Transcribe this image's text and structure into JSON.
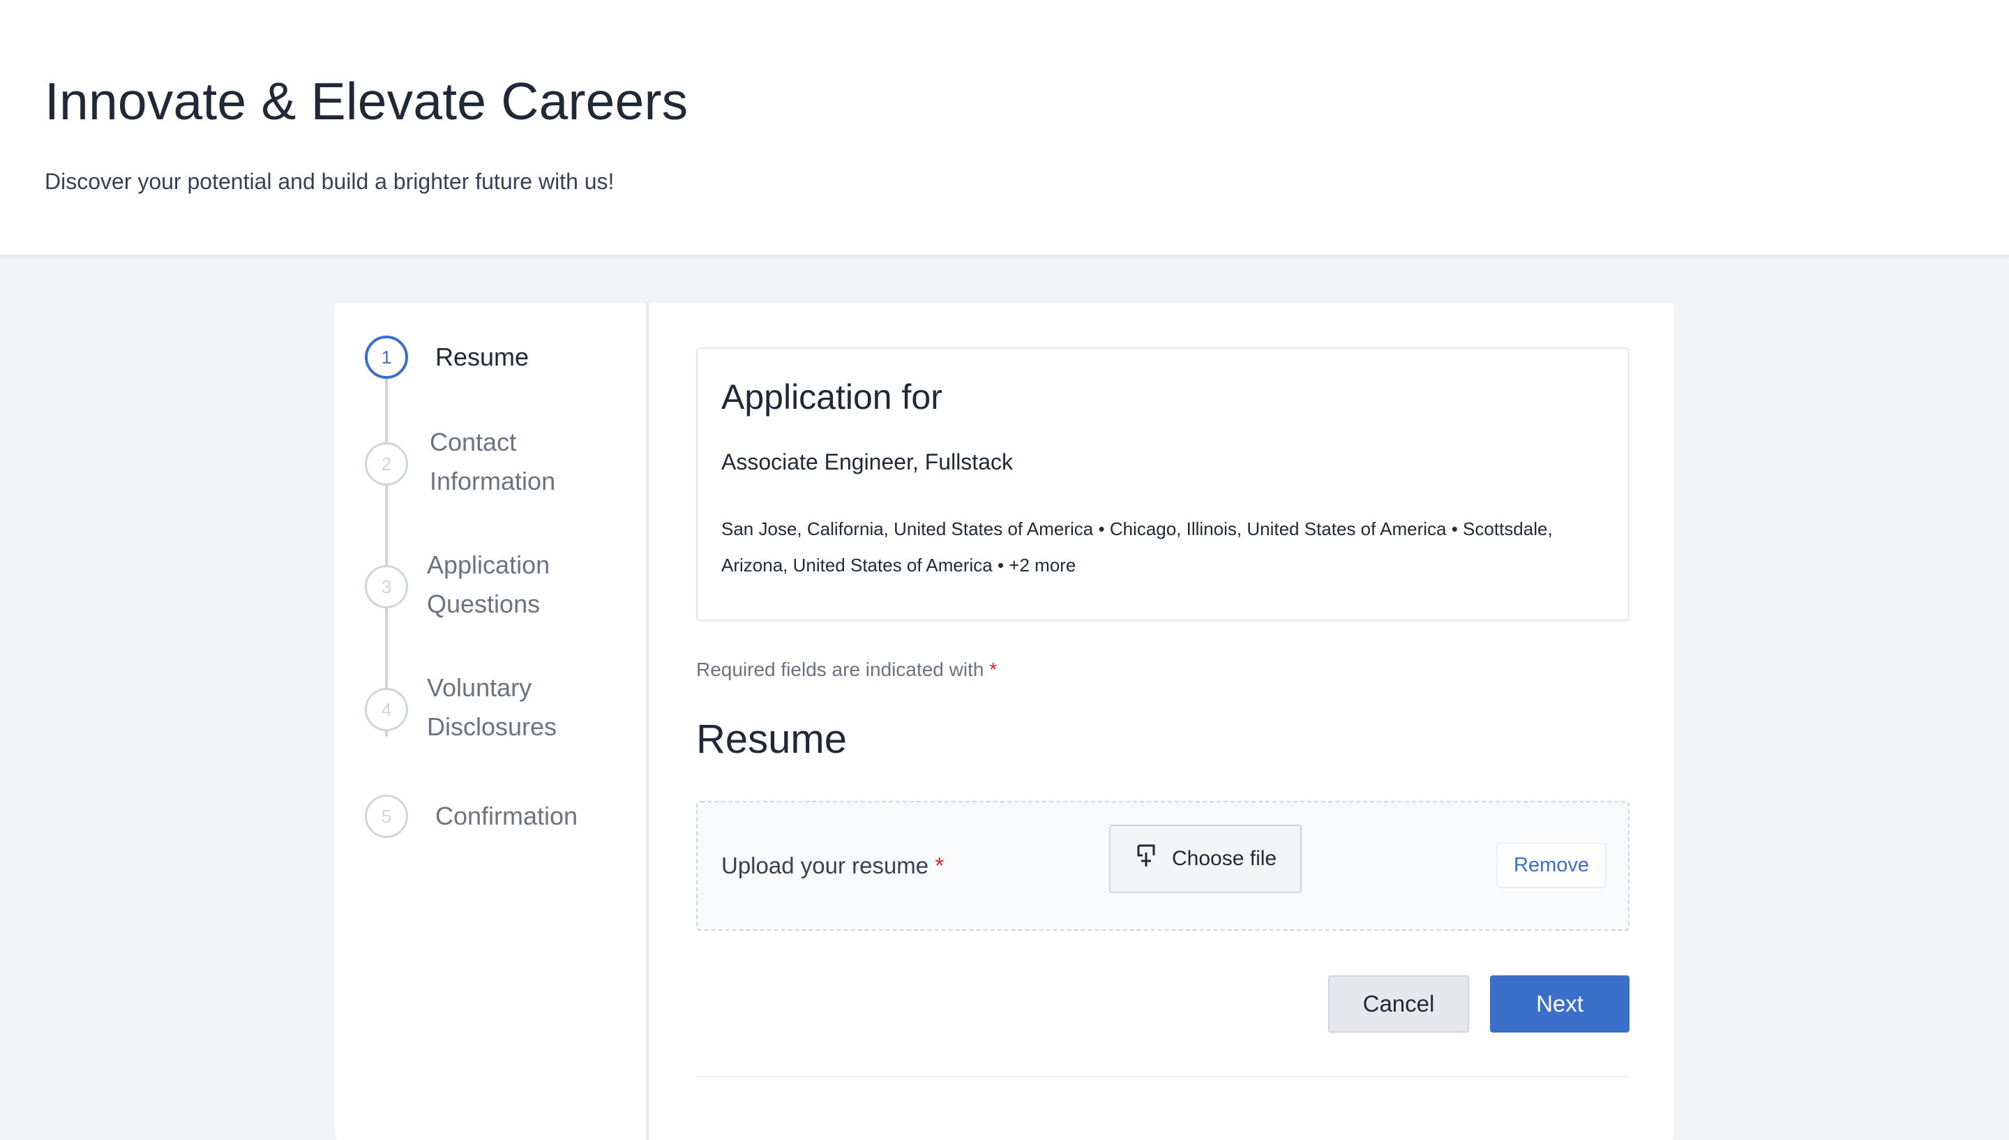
{
  "header": {
    "title": "Innovate & Elevate Careers",
    "subtitle": "Discover your potential and build a brighter future with us!"
  },
  "steps": [
    {
      "number": "1",
      "label": "Resume",
      "state": "active"
    },
    {
      "number": "2",
      "label_line1": "Contact",
      "label_line2": "Information",
      "state": "pending"
    },
    {
      "number": "3",
      "label_line1": "Application",
      "label_line2": "Questions",
      "state": "pending"
    },
    {
      "number": "4",
      "label_line1": "Voluntary",
      "label_line2": "Disclosures",
      "state": "pending"
    },
    {
      "number": "5",
      "label": "Confirmation",
      "state": "pending"
    }
  ],
  "application": {
    "heading": "Application for",
    "job_title": "Associate Engineer, Fullstack",
    "locations": "San Jose, California, United States of America • Chicago, Illinois, United States of America • Scottsdale, Arizona, United States of America • +2 more"
  },
  "form": {
    "required_note": "Required fields are indicated with",
    "required_marker": "*",
    "section_title": "Resume",
    "upload_label": "Upload your resume",
    "choose_file_label": "Choose file",
    "choose_file_icon": "upload-icon",
    "remove_label": "Remove",
    "cancel_label": "Cancel",
    "next_label": "Next"
  },
  "colors": {
    "accent": "#3b6fca",
    "required": "#dc2626",
    "page_bg": "#f3f4f6"
  }
}
